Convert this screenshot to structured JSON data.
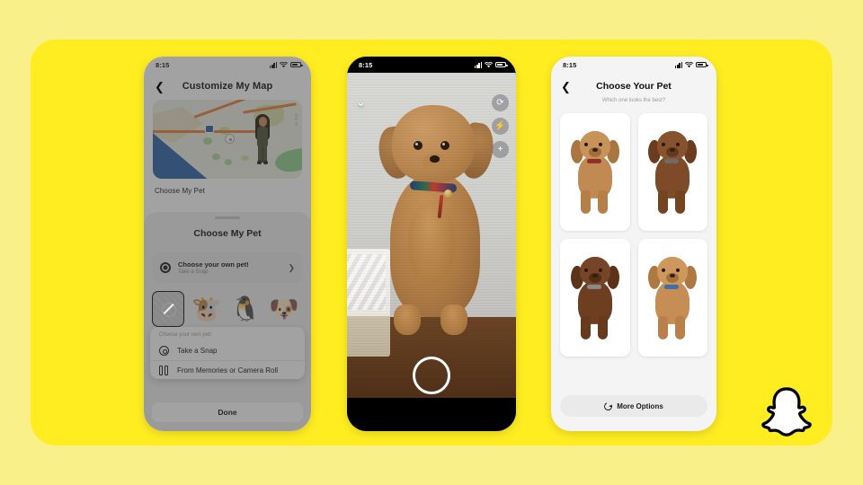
{
  "theme": {
    "page_background": "#FAF08A",
    "card_background": "#FFED22",
    "brand": "snapchat-yellow"
  },
  "brand_logo": {
    "name": "snapchat-ghost-logo",
    "fill": "#FFFFFF",
    "outline": "#000000"
  },
  "status_bar": {
    "time": "8:15",
    "cellular_icon": "signal-bars-icon",
    "wifi_icon": "wifi-icon",
    "battery_icon": "battery-icon"
  },
  "phone_map": {
    "back_icon": "chevron-left-icon",
    "title": "Customize My Map",
    "map": {
      "poi_icon": "map-poi-icon",
      "highway_shield": "highway-shield-icon",
      "street_label": "Zoo Dr",
      "avatar": "bitmoji-avatar"
    },
    "choose_my_pet_row": "Choose My Pet",
    "sheet": {
      "title": "Choose My Pet",
      "own_pet": {
        "icon": "camera-icon",
        "title": "Choose your own pet!",
        "subtitle": "Take a Snap",
        "chevron": "chevron-right-icon"
      },
      "pet_options": [
        {
          "name": "no-pet",
          "glyph": ""
        },
        {
          "name": "cow-pet",
          "glyph": "🐮"
        },
        {
          "name": "penguin-pet",
          "glyph": "🐧"
        },
        {
          "name": "dog-pet",
          "glyph": "🐶"
        }
      ],
      "popover": {
        "header": "Choose your own pet!",
        "items": [
          {
            "icon": "camera-icon",
            "label": "Take a Snap"
          },
          {
            "icon": "memories-icon",
            "label": "From Memories or Camera Roll"
          }
        ]
      },
      "done_label": "Done"
    }
  },
  "phone_camera": {
    "close_icon": "chevron-down-icon",
    "controls": [
      {
        "name": "flip-camera-icon",
        "glyph": "⟳"
      },
      {
        "name": "flash-icon",
        "glyph": "⚡"
      },
      {
        "name": "add-icon",
        "glyph": "+"
      }
    ],
    "shutter_button": "shutter-button",
    "subject": "brown-poodle-photo"
  },
  "phone_grid": {
    "back_icon": "chevron-left-icon",
    "title": "Choose Your Pet",
    "subtitle": "Which one looks the best?",
    "cards": [
      {
        "name": "pet-result-1",
        "coat": "#C08A52",
        "shade": "#9A6935"
      },
      {
        "name": "pet-result-2",
        "coat": "#7E4B28",
        "shade": "#5E351A"
      },
      {
        "name": "pet-result-3",
        "coat": "#6E3E20",
        "shade": "#4E2A14"
      },
      {
        "name": "pet-result-4",
        "coat": "#C68D55",
        "shade": "#A06C38"
      }
    ],
    "more_options": {
      "icon": "refresh-icon",
      "label": "More Options"
    }
  }
}
